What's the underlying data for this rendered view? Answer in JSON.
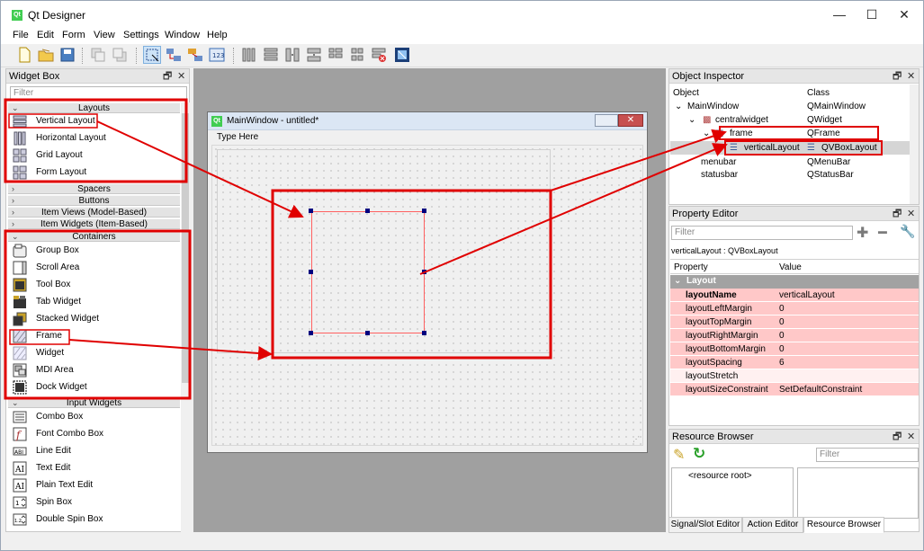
{
  "window": {
    "title": "Qt Designer",
    "logo": "Qt",
    "min": "—",
    "max": "☐",
    "close": "✕"
  },
  "menu": [
    "File",
    "Edit",
    "Form",
    "View",
    "Settings",
    "Window",
    "Help"
  ],
  "widget_box": {
    "title": "Widget Box",
    "filter_placeholder": "Filter",
    "categories": {
      "layouts": "Layouts",
      "spacers": "Spacers",
      "buttons": "Buttons",
      "item_views": "Item Views (Model-Based)",
      "item_widgets": "Item Widgets (Item-Based)",
      "containers": "Containers",
      "input_widgets": "Input Widgets"
    },
    "layouts": [
      "Vertical Layout",
      "Horizontal Layout",
      "Grid Layout",
      "Form Layout"
    ],
    "containers": [
      "Group Box",
      "Scroll Area",
      "Tool Box",
      "Tab Widget",
      "Stacked Widget",
      "Frame",
      "Widget",
      "MDI Area",
      "Dock Widget"
    ],
    "inputs": [
      "Combo Box",
      "Font Combo Box",
      "Line Edit",
      "Text Edit",
      "Plain Text Edit",
      "Spin Box",
      "Double Spin Box"
    ]
  },
  "form": {
    "title": "MainWindow - untitled*",
    "menu_placeholder": "Type Here"
  },
  "object_inspector": {
    "title": "Object Inspector",
    "col_object": "Object",
    "col_class": "Class",
    "rows": [
      {
        "name": "MainWindow",
        "cls": "QMainWindow"
      },
      {
        "name": "centralwidget",
        "cls": "QWidget"
      },
      {
        "name": "frame",
        "cls": "QFrame"
      },
      {
        "name": "verticalLayout",
        "cls": "QVBoxLayout"
      },
      {
        "name": "menubar",
        "cls": "QMenuBar"
      },
      {
        "name": "statusbar",
        "cls": "QStatusBar"
      }
    ]
  },
  "property_editor": {
    "title": "Property Editor",
    "filter_placeholder": "Filter",
    "object_label": "verticalLayout : QVBoxLayout",
    "col_property": "Property",
    "col_value": "Value",
    "group": "Layout",
    "rows": [
      {
        "name": "layoutName",
        "value": "verticalLayout"
      },
      {
        "name": "layoutLeftMargin",
        "value": "0"
      },
      {
        "name": "layoutTopMargin",
        "value": "0"
      },
      {
        "name": "layoutRightMargin",
        "value": "0"
      },
      {
        "name": "layoutBottomMargin",
        "value": "0"
      },
      {
        "name": "layoutSpacing",
        "value": "6"
      },
      {
        "name": "layoutStretch",
        "value": ""
      },
      {
        "name": "layoutSizeConstraint",
        "value": "SetDefaultConstraint"
      }
    ]
  },
  "resource_browser": {
    "title": "Resource Browser",
    "filter_placeholder": "Filter",
    "root": "<resource root>"
  },
  "tabs": [
    "Signal/Slot Editor",
    "Action Editor",
    "Resource Browser"
  ],
  "dock_float": "🗗",
  "dock_close": "✕",
  "accent": "#e00000"
}
